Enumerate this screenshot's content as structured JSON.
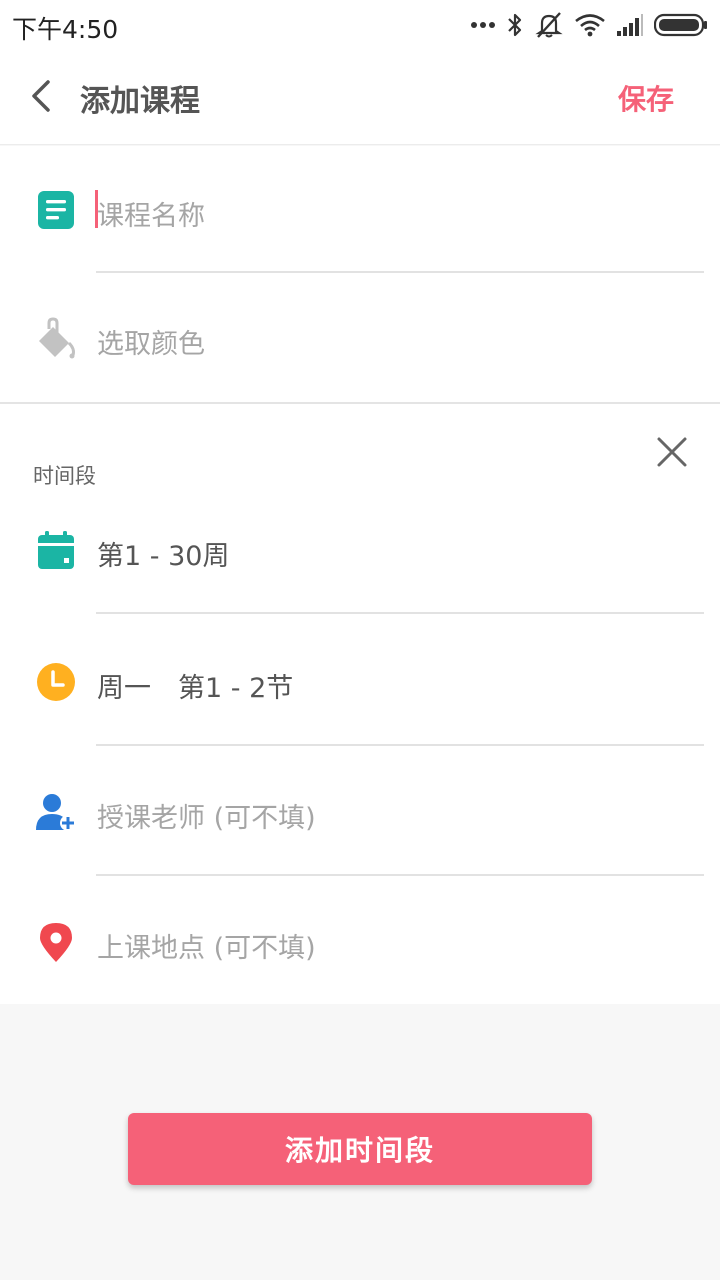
{
  "status_bar": {
    "time": "下午4:50",
    "icons": [
      "more-dots-icon",
      "bluetooth-icon",
      "silent-icon",
      "wifi-icon",
      "signal-icon",
      "battery-icon"
    ]
  },
  "header": {
    "title": "添加课程",
    "save_label": "保存",
    "back_icon": "back-arrow-icon"
  },
  "course_form": {
    "name_placeholder": "课程名称",
    "color_label": "选取颜色"
  },
  "time_slot": {
    "section_label": "时间段",
    "weeks": "第1 - 30周",
    "day_period": "周一　第1 - 2节",
    "teacher_placeholder": "授课老师 (可不填)",
    "location_placeholder": "上课地点 (可不填)"
  },
  "actions": {
    "add_time_slot_label": "添加时间段"
  },
  "colors": {
    "accent": "#f56178",
    "teal": "#1bb5a4",
    "orange": "#ffb020",
    "blue": "#2b7bd8",
    "red": "#f0484f"
  }
}
